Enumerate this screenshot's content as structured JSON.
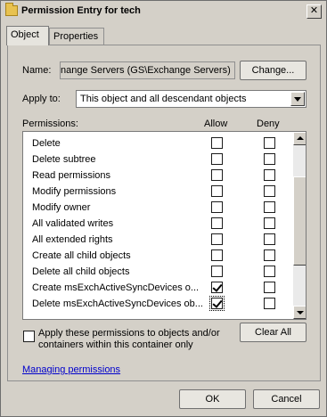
{
  "window": {
    "title": "Permission Entry for tech",
    "close_glyph": "✕"
  },
  "tabs": [
    {
      "label": "Object",
      "active": true
    },
    {
      "label": "Properties",
      "active": false
    }
  ],
  "name": {
    "label": "Name:",
    "value": "nange Servers (GS\\Exchange Servers)",
    "change_button": "Change..."
  },
  "apply_to": {
    "label": "Apply to:",
    "value": "This object and all descendant objects"
  },
  "permissions": {
    "label": "Permissions:",
    "allow_header": "Allow",
    "deny_header": "Deny",
    "rows": [
      {
        "name": "Delete",
        "allow": false,
        "deny": false
      },
      {
        "name": "Delete subtree",
        "allow": false,
        "deny": false
      },
      {
        "name": "Read permissions",
        "allow": false,
        "deny": false
      },
      {
        "name": "Modify permissions",
        "allow": false,
        "deny": false
      },
      {
        "name": "Modify owner",
        "allow": false,
        "deny": false
      },
      {
        "name": "All validated writes",
        "allow": false,
        "deny": false
      },
      {
        "name": "All extended rights",
        "allow": false,
        "deny": false
      },
      {
        "name": "Create all child objects",
        "allow": false,
        "deny": false
      },
      {
        "name": "Delete all child objects",
        "allow": false,
        "deny": false
      },
      {
        "name": "Create msExchActiveSyncDevices o...",
        "allow": true,
        "deny": false
      },
      {
        "name": "Delete msExchActiveSyncDevices ob...",
        "allow": true,
        "deny": false
      }
    ]
  },
  "apply_only": {
    "line1": "Apply these permissions to objects and/or",
    "line2": "containers within this container only",
    "checked": false
  },
  "clear_all_button": "Clear All",
  "managing_link": "Managing permissions",
  "ok_button": "OK",
  "cancel_button": "Cancel"
}
